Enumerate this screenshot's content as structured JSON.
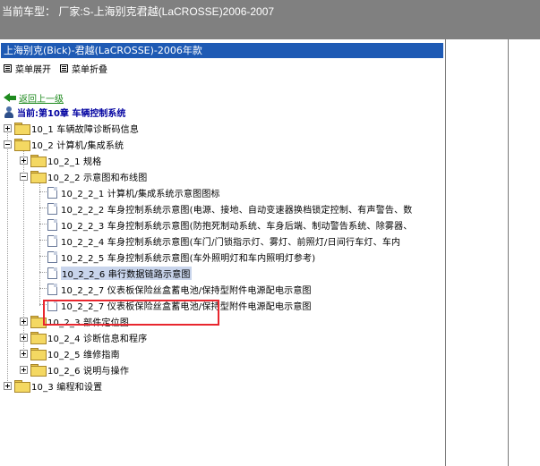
{
  "topbar": {
    "title": "当前车型：  厂家:S-上海别克君越(LaCROSSE)2006-2007"
  },
  "pane": {
    "header": "上海别克(Bick)-君越(LaCROSSE)-2006年款",
    "expand_all": "菜单展开",
    "collapse_all": "菜单折叠",
    "back": "返回上一级",
    "current": "当前:第10章 车辆控制系统"
  },
  "tree": {
    "n1": "10_1 车辆故障诊断码信息",
    "n2": "10_2 计算机/集成系统",
    "n2_1": "10_2_1 规格",
    "n2_2": "10_2_2 示意图和布线图",
    "d1": "10_2_2_1 计算机/集成系统示意图图标",
    "d2": "10_2_2_2 车身控制系统示意图(电源、接地、自动变速器换档锁定控制、有声警告、数",
    "d3": "10_2_2_3 车身控制系统示意图(防抱死制动系统、车身后端、制动警告系统、除雾器、",
    "d4": "10_2_2_4 车身控制系统示意图(车门/门锁指示灯、雾灯、前照灯/日间行车灯、车内",
    "d5": "10_2_2_5 车身控制系统示意图(车外照明灯和车内照明灯参考)",
    "d6": "10_2_2_6 串行数据链路示意图",
    "d7": "10_2_2_7 仪表板保险丝盒蓄电池/保持型附件电源配电示意图",
    "d8": "10_2_2_7 仪表板保险丝盒蓄电池/保持型附件电源配电示意图",
    "n2_3": "10_2_3 部件定位图",
    "n2_4": "10_2_4 诊断信息和程序",
    "n2_5": "10_2_5 维修指南",
    "n2_6": "10_2_6 说明与操作",
    "n3": "10_3 编程和设置"
  }
}
